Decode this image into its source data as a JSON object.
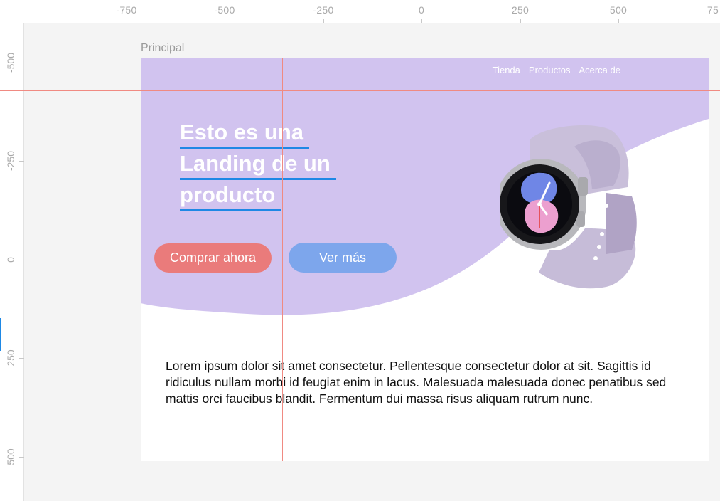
{
  "ruler": {
    "top_ticks": [
      "-750",
      "-500",
      "-250",
      "0",
      "250",
      "500",
      "75"
    ],
    "left_ticks": [
      "-500",
      "-250",
      "0",
      "250",
      "500"
    ]
  },
  "frame": {
    "label": "Principal"
  },
  "nav": {
    "items": [
      "Tienda",
      "Productos",
      "Acerca de"
    ]
  },
  "hero": {
    "headline_lines": [
      "Esto es una",
      "Landing de un",
      "producto"
    ],
    "buy_button": "Comprar ahora",
    "more_button": "Ver más"
  },
  "body": {
    "paragraph": "Lorem ipsum dolor sit amet consectetur. Pellentesque consectetur dolor at sit. Sagittis id ridiculus nullam morbi id feugiat enim in lacus. Malesuada malesuada donec penatibus sed mattis orci faucibus blandit. Fermentum dui massa risus aliquam rutrum nunc."
  },
  "colors": {
    "hero_purple": "#d1c3ef",
    "buy_button": "#ea7b7b",
    "more_button": "#7da6ec",
    "guide_line": "#f08a82",
    "headline_underline": "#1e88e5"
  },
  "icons": {
    "product": "smartwatch-icon"
  }
}
